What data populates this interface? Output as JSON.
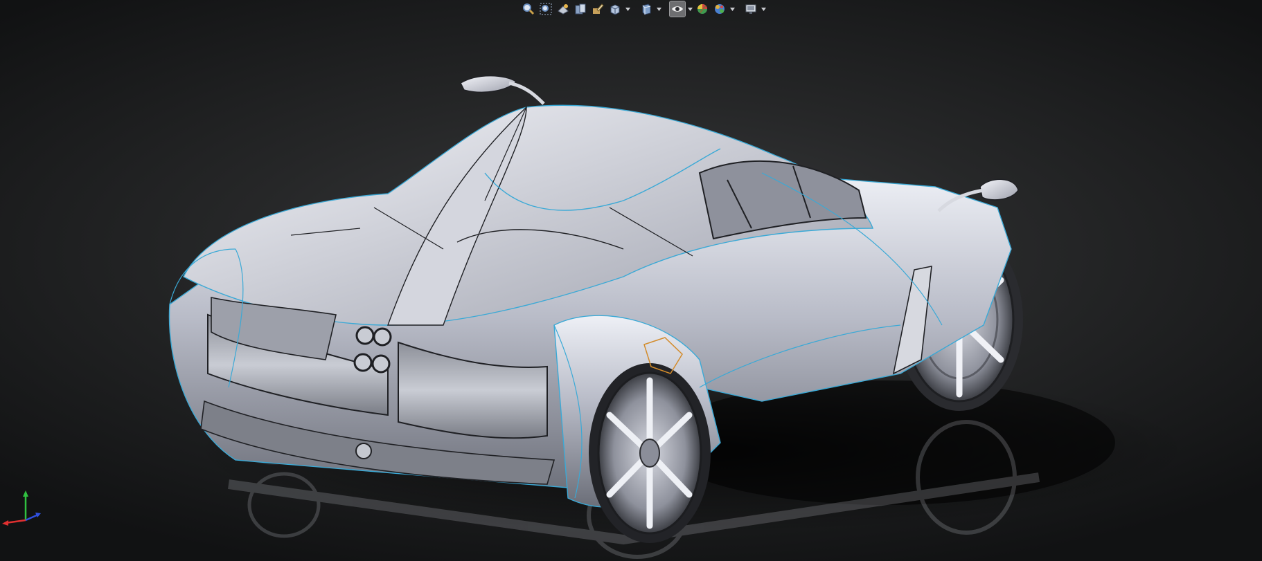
{
  "window": {
    "title": ""
  },
  "heads_up_toolbar": {
    "tools": [
      {
        "id": "zoom-to-fit",
        "icon": "zoom-to-fit-icon"
      },
      {
        "id": "zoom-to-area",
        "icon": "zoom-to-area-icon"
      },
      {
        "id": "previous-view",
        "icon": "previous-view-icon"
      },
      {
        "id": "section-view",
        "icon": "section-view-icon"
      },
      {
        "id": "dynamic-annotation",
        "icon": "dynamic-annotation-icon"
      },
      {
        "id": "view-orientation",
        "icon": "view-orientation-icon",
        "dropdown": true
      },
      {
        "id": "display-style",
        "icon": "display-style-icon",
        "dropdown": true
      },
      {
        "id": "hide-show-items",
        "icon": "hide-show-items-icon",
        "dropdown": true,
        "active": true
      },
      {
        "id": "edit-appearance",
        "icon": "edit-appearance-icon"
      },
      {
        "id": "apply-scene",
        "icon": "apply-scene-icon",
        "dropdown": true
      },
      {
        "id": "view-settings",
        "icon": "view-settings-icon",
        "dropdown": true
      }
    ]
  },
  "colors": {
    "background_center": "#3a3b3d",
    "background_edge": "#111213",
    "body_surface": "#b9bcc8",
    "edge_lines": "#3aa9d6",
    "selected_face_edge": "#d38b2a",
    "triad_x": "#e03030",
    "triad_y": "#30c040",
    "triad_z": "#3050e0"
  },
  "model": {
    "icon": "car-model-icon"
  },
  "triad": {
    "icon": "coordinate-triad-icon"
  }
}
